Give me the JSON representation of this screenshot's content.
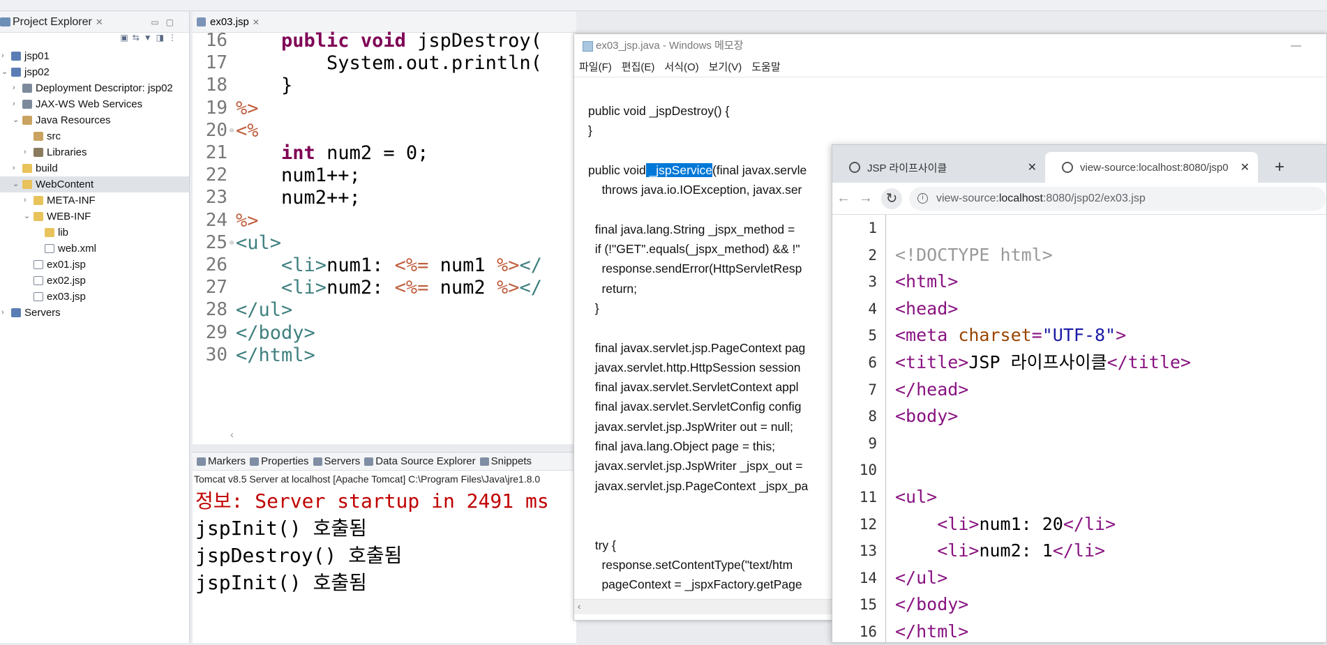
{
  "explorer": {
    "tab_label": "Project Explorer",
    "tree": [
      {
        "label": "jsp01",
        "depth": 0,
        "expanded": false,
        "icon": "project-icon"
      },
      {
        "label": "jsp02",
        "depth": 0,
        "expanded": true,
        "icon": "project-icon"
      },
      {
        "label": "Deployment Descriptor: jsp02",
        "depth": 1,
        "expanded": false,
        "icon": "descriptor-icon"
      },
      {
        "label": "JAX-WS Web Services",
        "depth": 1,
        "expanded": false,
        "icon": "webservice-icon"
      },
      {
        "label": "Java Resources",
        "depth": 1,
        "expanded": true,
        "icon": "package-icon"
      },
      {
        "label": "src",
        "depth": 2,
        "expanded": null,
        "icon": "package-icon"
      },
      {
        "label": "Libraries",
        "depth": 2,
        "expanded": false,
        "icon": "library-icon"
      },
      {
        "label": "build",
        "depth": 1,
        "expanded": false,
        "icon": "folder-icon"
      },
      {
        "label": "WebContent",
        "depth": 1,
        "expanded": true,
        "icon": "folder-icon",
        "selected": true
      },
      {
        "label": "META-INF",
        "depth": 2,
        "expanded": false,
        "icon": "folder-icon"
      },
      {
        "label": "WEB-INF",
        "depth": 2,
        "expanded": true,
        "icon": "folder-icon"
      },
      {
        "label": "lib",
        "depth": 3,
        "expanded": null,
        "icon": "folder-icon"
      },
      {
        "label": "web.xml",
        "depth": 3,
        "expanded": null,
        "icon": "xml-file-icon"
      },
      {
        "label": "ex01.jsp",
        "depth": 2,
        "expanded": null,
        "icon": "jsp-file-icon"
      },
      {
        "label": "ex02.jsp",
        "depth": 2,
        "expanded": null,
        "icon": "jsp-file-icon"
      },
      {
        "label": "ex03.jsp",
        "depth": 2,
        "expanded": null,
        "icon": "jsp-file-icon"
      },
      {
        "label": "Servers",
        "depth": 0,
        "expanded": false,
        "icon": "project-icon"
      }
    ]
  },
  "editor": {
    "tab_label": "ex03.jsp",
    "lines": [
      {
        "num": "16",
        "text": "    public void jspDestroy("
      },
      {
        "num": "17",
        "text": "        System.out.println("
      },
      {
        "num": "18",
        "text": "    }"
      },
      {
        "num": "19",
        "text": "%>"
      },
      {
        "num": "20",
        "text": "<%"
      },
      {
        "num": "21",
        "text": "    int num2 = 0;"
      },
      {
        "num": "22",
        "text": "    num1++;"
      },
      {
        "num": "23",
        "text": "    num2++;"
      },
      {
        "num": "24",
        "text": "%>"
      },
      {
        "num": "25",
        "text": "<ul>"
      },
      {
        "num": "26",
        "text": "    <li>num1: <%= num1 %></"
      },
      {
        "num": "27",
        "text": "    <li>num2: <%= num2 %></"
      },
      {
        "num": "28",
        "text": "</ul>"
      },
      {
        "num": "29",
        "text": "</body>"
      },
      {
        "num": "30",
        "text": "</html>"
      }
    ]
  },
  "console": {
    "tabs": [
      "Markers",
      "Properties",
      "Servers",
      "Data Source Explorer",
      "Snippets"
    ],
    "description": "Tomcat v8.5 Server at localhost [Apache Tomcat] C:\\Program Files\\Java\\jre1.8.0",
    "lines": [
      "정보: Server startup in 2491 ms",
      "jspInit() 호출됨",
      "jspDestroy() 호출됨",
      "jspInit() 호출됨"
    ]
  },
  "notepad": {
    "title": "ex03_jsp.java - Windows 메모장",
    "menu": [
      "파일(F)",
      "편집(E)",
      "서식(O)",
      "보기(V)",
      "도움말"
    ],
    "lines": [
      "public void _jspDestroy() {",
      "}",
      "",
      "public void _jspService(final javax.servle",
      "    throws java.io.IOException, javax.ser",
      "",
      "  final java.lang.String _jspx_method =",
      "  if (!\"GET\".equals(_jspx_method) && !\"",
      "    response.sendError(HttpServletResp",
      "    return;",
      "  }",
      "",
      "  final javax.servlet.jsp.PageContext pag",
      "  javax.servlet.http.HttpSession session",
      "  final javax.servlet.ServletContext appl",
      "  final javax.servlet.ServletConfig config",
      "  javax.servlet.jsp.JspWriter out = null;",
      "  final java.lang.Object page = this;",
      "  javax.servlet.jsp.JspWriter _jspx_out =",
      "  javax.servlet.jsp.PageContext _jspx_pa",
      "",
      "",
      "  try {",
      "    response.setContentType(\"text/htm",
      "    pageContext = _jspxFactory.getPage"
    ],
    "highlight": "_jspService"
  },
  "browser": {
    "tab1_title": "JSP 라이프사이클",
    "tab2_title": "view-source:localhost:8080/jsp0",
    "url_prefix": "view-source:",
    "url_host": "localhost",
    "url_rest": ":8080/jsp02/ex03.jsp",
    "source_lines": [
      {
        "num": "1",
        "html": ""
      },
      {
        "num": "2",
        "html": "<span class=\"doctype\">&lt;!DOCTYPE html&gt;</span>"
      },
      {
        "num": "3",
        "html": "<span class=\"htag\">&lt;html&gt;</span>"
      },
      {
        "num": "4",
        "html": "<span class=\"htag\">&lt;head&gt;</span>"
      },
      {
        "num": "5",
        "html": "<span class=\"htag\">&lt;meta </span><span class=\"attn\">charset</span><span class=\"htag\">=</span><span class=\"attv\">\"UTF-8\"</span><span class=\"htag\">&gt;</span>"
      },
      {
        "num": "6",
        "html": "<span class=\"htag\">&lt;title&gt;</span>JSP 라이프사이클<span class=\"htag\">&lt;/title&gt;</span>"
      },
      {
        "num": "7",
        "html": "<span class=\"htag\">&lt;/head&gt;</span>"
      },
      {
        "num": "8",
        "html": "<span class=\"htag\">&lt;body&gt;</span>"
      },
      {
        "num": "9",
        "html": ""
      },
      {
        "num": "10",
        "html": ""
      },
      {
        "num": "11",
        "html": "<span class=\"htag\">&lt;ul&gt;</span>"
      },
      {
        "num": "12",
        "html": "    <span class=\"htag\">&lt;li&gt;</span>num1: 20<span class=\"htag\">&lt;/li&gt;</span>"
      },
      {
        "num": "13",
        "html": "    <span class=\"htag\">&lt;li&gt;</span>num2: 1<span class=\"htag\">&lt;/li&gt;</span>"
      },
      {
        "num": "14",
        "html": "<span class=\"htag\">&lt;/ul&gt;</span>"
      },
      {
        "num": "15",
        "html": "<span class=\"htag\">&lt;/body&gt;</span>"
      },
      {
        "num": "16",
        "html": "<span class=\"htag\">&lt;/html&gt;</span>"
      }
    ]
  }
}
